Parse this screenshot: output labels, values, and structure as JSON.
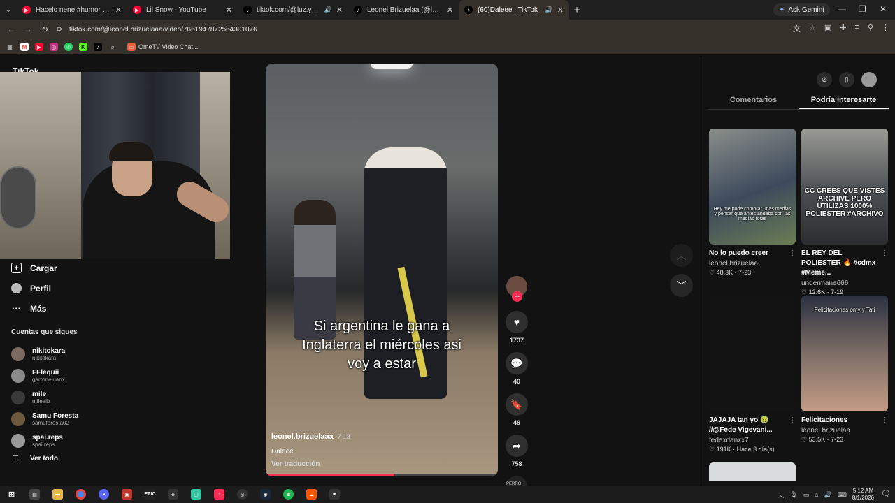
{
  "browser": {
    "tabs": [
      {
        "label": "Hacelo nene #humor #memes",
        "favicon": "youtube-icon",
        "active": false,
        "audio": false
      },
      {
        "label": "Lil Snow - YouTube",
        "favicon": "youtube-icon",
        "active": false,
        "audio": false
      },
      {
        "label": "tiktok.com/@luz.yancovich",
        "favicon": "tiktok-icon",
        "active": false,
        "audio": true
      },
      {
        "label": "Leonel.Brizuelaa (@leonel.briz",
        "favicon": "tiktok-icon",
        "active": false,
        "audio": false
      },
      {
        "label": "(60)Daleee | TikTok",
        "favicon": "tiktok-icon",
        "active": true,
        "audio": true
      }
    ],
    "ask_gemini": "Ask Gemini",
    "url": "tiktok.com/@leonel.brizuelaaa/video/7661947872564301076",
    "bookmarks": {
      "ometv": "OmeTV Video Chat..."
    }
  },
  "tiktok": {
    "logo_partial": "TikTok",
    "nav": [
      {
        "label": "Cargar",
        "icon": "upload-plus-icon"
      },
      {
        "label": "Perfil",
        "icon": "profile-avatar-icon"
      },
      {
        "label": "Más",
        "icon": "more-dots-icon"
      }
    ],
    "following_title": "Cuentas que sigues",
    "following": [
      {
        "name": "nikitokara",
        "user": "nikitokara"
      },
      {
        "name": "FFlequii",
        "user": "garroneluanx"
      },
      {
        "name": "mile",
        "user": "mileaib_"
      },
      {
        "name": "Samu Foresta",
        "user": "samuforesta02"
      },
      {
        "name": "spai.reps",
        "user": "spai.reps"
      }
    ],
    "see_all": "Ver todo",
    "video": {
      "caption_lines": [
        "Si argentina le gana a",
        "Inglaterra el miércoles asi",
        "voy a estar"
      ],
      "author": "leonel.brizuelaaa",
      "date": "7-13",
      "description": "Daleee",
      "translate": "Ver traducción",
      "progress": 0.55
    },
    "actions": {
      "likes": "1737",
      "comments": "40",
      "saves": "48",
      "shares": "758",
      "disc_label": "PERRO YOM"
    },
    "panel": {
      "tabs": [
        "Comentarios",
        "Podría interesarte"
      ],
      "active_tab": 1,
      "cards": [
        {
          "title": "No lo puedo creer",
          "author": "leonel.brizuelaa",
          "stats": "♡ 48.3K · 7-23",
          "thumb_text": "Hey me pude comprar unas medias y pensar que antes andaba con las medias rotas"
        },
        {
          "title": "EL REY DEL POLIESTER 🔥 #cdmx #Meme...",
          "author": "undermane666",
          "stats": "♡ 12.6K · 7-19",
          "thumb_text": "CC CREES QUE VISTES ARCHIVE PERO UTILIZAS 1000% POLIESTER #ARCHIVO"
        },
        {
          "title": "JAJAJA tan yo 🤢 //@Fede Vigevani...",
          "author": "fedexdanxx7",
          "stats": "♡ 191K · Hace 3 día(s)",
          "thumb_text": ""
        },
        {
          "title": "Felicitaciones",
          "author": "leonel.brizuelaa",
          "stats": "♡ 53.5K · 7-23",
          "thumb_text": "Felicitaciones omy y Tati"
        }
      ]
    }
  },
  "taskbar": {
    "time": "5:12 AM",
    "date": "8/1/2026"
  }
}
